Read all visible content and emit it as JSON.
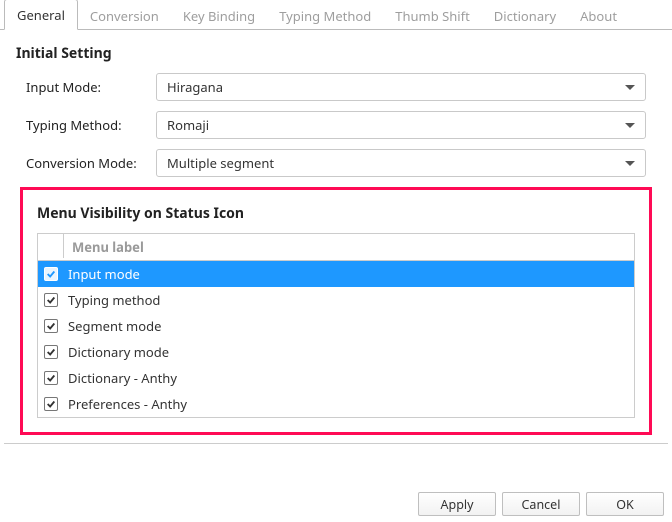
{
  "tabs": {
    "items": [
      "General",
      "Conversion",
      "Key Binding",
      "Typing Method",
      "Thumb Shift",
      "Dictionary",
      "About"
    ],
    "active_index": 0
  },
  "section1": {
    "title": "Initial Setting",
    "rows": [
      {
        "label": "Input Mode:",
        "value": "Hiragana"
      },
      {
        "label": "Typing Method:",
        "value": "Romaji"
      },
      {
        "label": "Conversion Mode:",
        "value": "Multiple segment"
      }
    ]
  },
  "section2": {
    "title": "Menu Visibility on Status Icon",
    "header": "Menu label",
    "items": [
      {
        "label": "Input mode",
        "checked": true,
        "selected": true
      },
      {
        "label": "Typing method",
        "checked": true,
        "selected": false
      },
      {
        "label": "Segment mode",
        "checked": true,
        "selected": false
      },
      {
        "label": "Dictionary mode",
        "checked": true,
        "selected": false
      },
      {
        "label": "Dictionary - Anthy",
        "checked": true,
        "selected": false
      },
      {
        "label": "Preferences - Anthy",
        "checked": true,
        "selected": false
      }
    ]
  },
  "buttons": {
    "apply": "Apply",
    "cancel": "Cancel",
    "ok": "OK"
  },
  "watermark": {
    "big": "",
    "small": ""
  }
}
